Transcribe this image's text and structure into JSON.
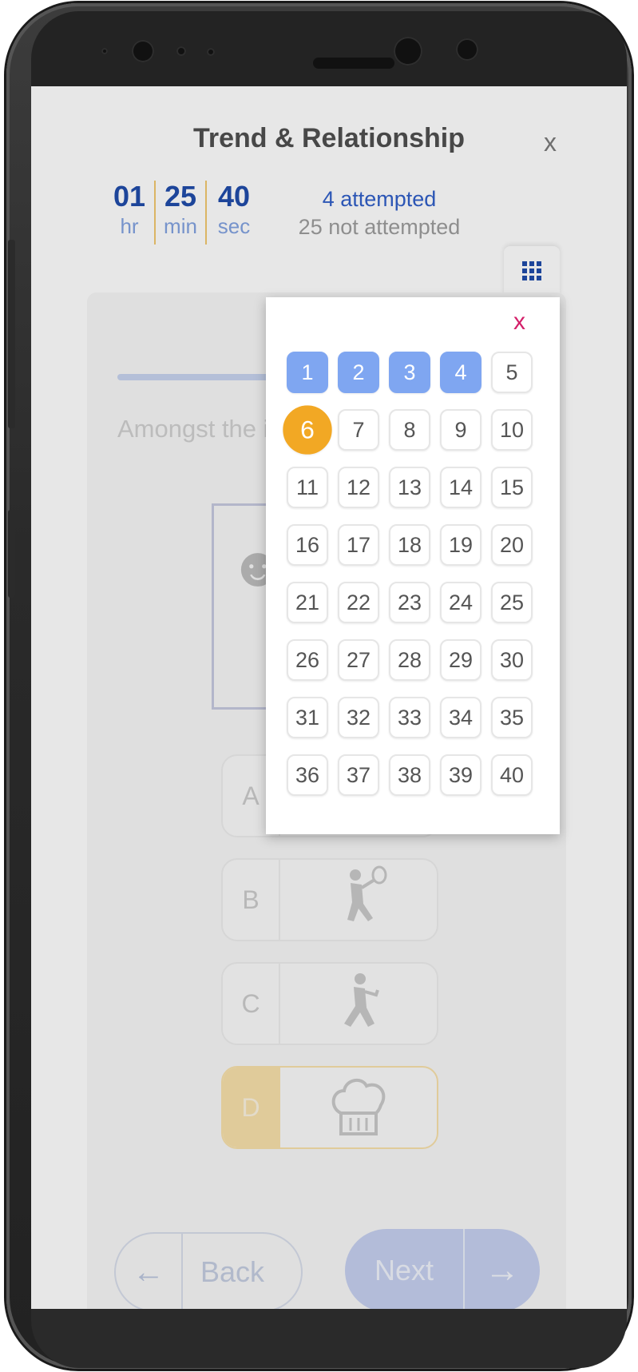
{
  "header": {
    "title": "Trend & Relationship",
    "close_label": "x"
  },
  "timer": {
    "hours": "01",
    "hours_label": "hr",
    "minutes": "25",
    "minutes_label": "min",
    "seconds": "40",
    "seconds_label": "sec"
  },
  "status": {
    "attempted": "4 attempted",
    "not_attempted": "25 not attempted"
  },
  "question": {
    "text": "Amongst the image would"
  },
  "options": [
    {
      "letter": "A",
      "icon": "hidden-option-icon"
    },
    {
      "letter": "B",
      "icon": "tennis-player-icon"
    },
    {
      "letter": "C",
      "icon": "waiter-running-icon"
    },
    {
      "letter": "D",
      "icon": "chef-hat-icon",
      "selected": true
    }
  ],
  "nav": {
    "back_label": "Back",
    "next_label": "Next"
  },
  "navigator": {
    "close_label": "x",
    "questions": [
      "1",
      "2",
      "3",
      "4",
      "5",
      "6",
      "7",
      "8",
      "9",
      "10",
      "11",
      "12",
      "13",
      "14",
      "15",
      "16",
      "17",
      "18",
      "19",
      "20",
      "21",
      "22",
      "23",
      "24",
      "25",
      "26",
      "27",
      "28",
      "29",
      "30",
      "31",
      "32",
      "33",
      "34",
      "35",
      "36",
      "37",
      "38",
      "39",
      "40"
    ],
    "attempted": [
      "1",
      "2",
      "3",
      "4"
    ],
    "current": "6"
  },
  "colors": {
    "brand_blue": "#1a47a8",
    "attempted_blue": "#7fa6f1",
    "current_orange": "#f2a824",
    "close_pink": "#d4206a"
  }
}
